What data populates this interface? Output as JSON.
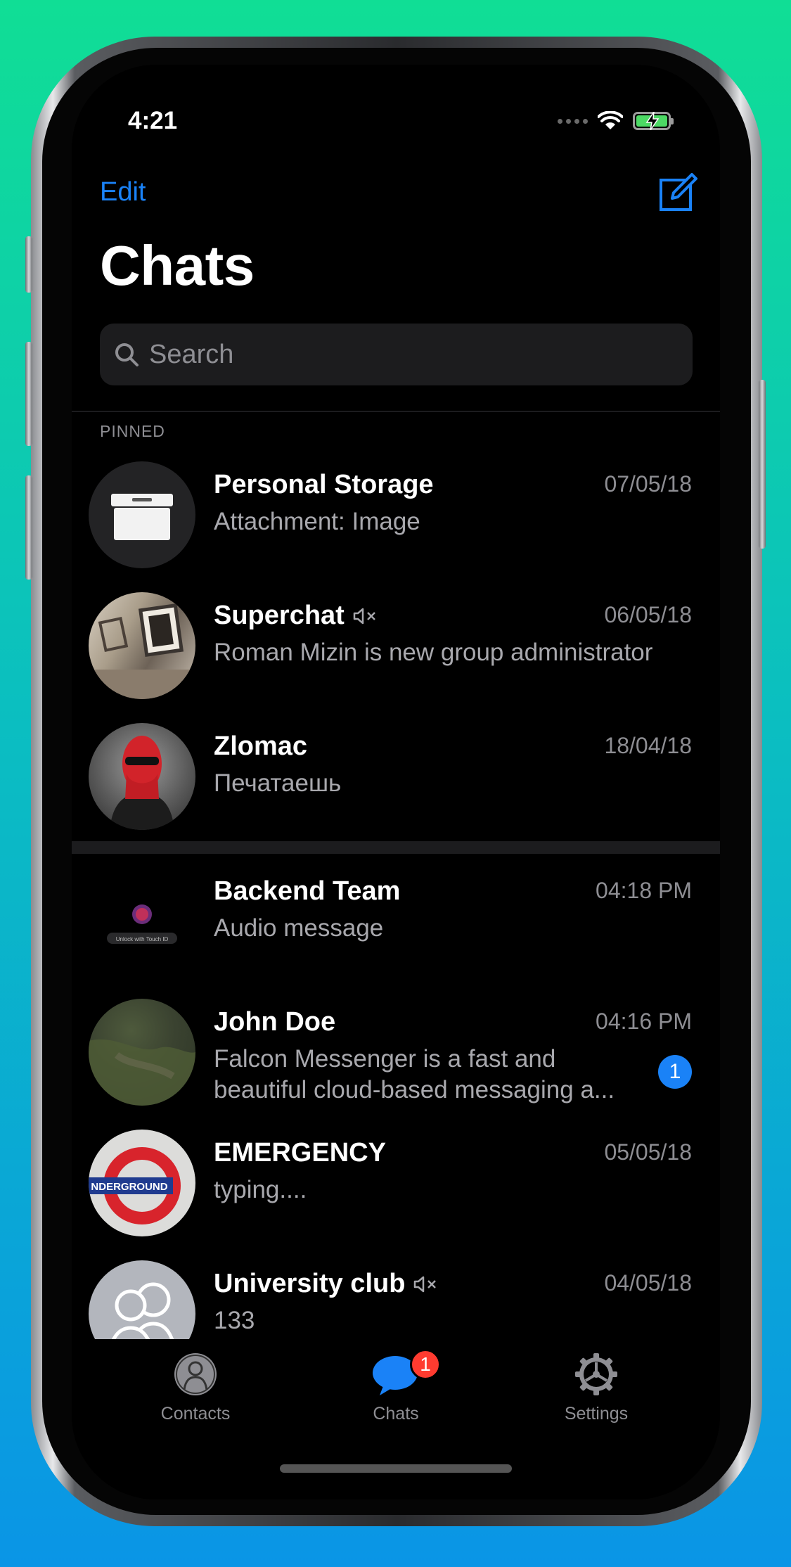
{
  "status": {
    "time": "4:21"
  },
  "nav": {
    "edit_label": "Edit",
    "title": "Chats"
  },
  "search": {
    "placeholder": "Search"
  },
  "sections": {
    "pinned_label": "PINNED"
  },
  "chats": [
    {
      "name": "Personal Storage",
      "date": "07/05/18",
      "message": "Attachment: Image",
      "muted": false,
      "avatar": "storage-box-icon"
    },
    {
      "name": "Superchat",
      "date": "06/05/18",
      "message": "Roman Mizin is new group administrator",
      "muted": true,
      "avatar": "photo"
    },
    {
      "name": "Zlomac",
      "date": "18/04/18",
      "message": "Печатаешь",
      "muted": false,
      "avatar": "photo"
    },
    {
      "name": "Backend Team",
      "date": "04:18 PM",
      "message": "Audio message",
      "muted": false,
      "avatar": "touch-id-image",
      "avatar_caption": "Unlock with Touch ID"
    },
    {
      "name": "John Doe",
      "date": "04:16 PM",
      "message": "Falcon Messenger is a fast and beautiful cloud-based messaging a...",
      "muted": false,
      "unread": "1",
      "avatar": "photo"
    },
    {
      "name": "EMERGENCY",
      "date": "05/05/18",
      "message": "typing....",
      "muted": false,
      "avatar": "underground-sign",
      "avatar_caption": "NDERGROUND"
    },
    {
      "name": "University club",
      "date": "04/05/18",
      "message": "133",
      "muted": true,
      "avatar": "group-placeholder-icon"
    }
  ],
  "tabbar": {
    "contacts_label": "Contacts",
    "chats_label": "Chats",
    "chats_badge": "1",
    "settings_label": "Settings"
  },
  "colors": {
    "accent": "#1a82f7",
    "badge_red": "#ff3b30",
    "background": "#000000",
    "secondary_text": "#8e8e93"
  }
}
